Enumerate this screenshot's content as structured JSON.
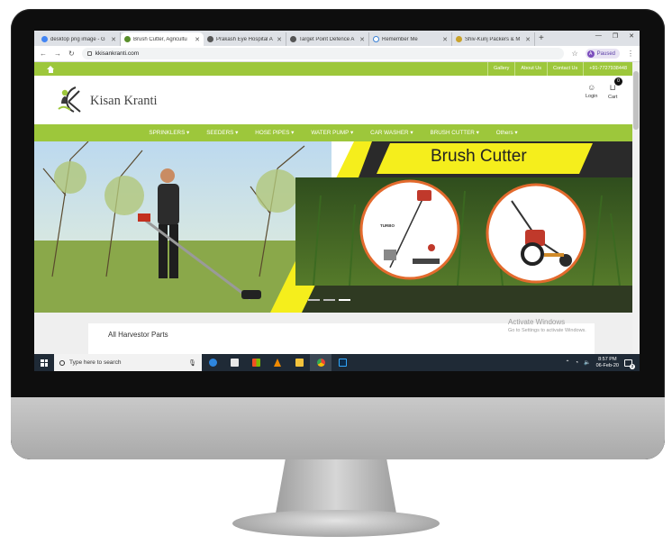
{
  "browser": {
    "tabs": [
      {
        "label": "desktop png image - G",
        "favicon_color": "#4285f4",
        "active": false
      },
      {
        "label": "Brush Cutter, Agricultu",
        "favicon_color": "#5a8f2c",
        "active": true
      },
      {
        "label": "Prakash Eye Hospital A",
        "favicon_color": "#555555",
        "active": false
      },
      {
        "label": "Target Point Defence A",
        "favicon_color": "#555555",
        "active": false
      },
      {
        "label": "Remember Me",
        "favicon_color": "#3b82d6",
        "active": false
      },
      {
        "label": "Shiv-Kunj Packers & M",
        "favicon_color": "#c9a22a",
        "active": false
      }
    ],
    "url": "kkisankranti.com",
    "profile_initial": "A",
    "profile_status": "Paused"
  },
  "site": {
    "toplinks": [
      "Gallery",
      "About Us",
      "Contact Us",
      "+91-7727938448"
    ],
    "logo_text": "Kisan Kranti",
    "header_actions": {
      "login": "Login",
      "cart": "Cart",
      "cart_count": "0"
    },
    "nav": [
      "SPRINKLERS",
      "SEEDERS",
      "HOSE PIPES",
      "WATER PUMP",
      "CAR WASHER",
      "BRUSH CUTTER",
      "Others"
    ],
    "hero": {
      "title": "Brush Cutter",
      "slide_count": 3,
      "active_slide": 3,
      "product_brand": "TURBO"
    },
    "section_title": "All Harvestor Parts"
  },
  "watermark": {
    "line1": "Activate Windows",
    "line2": "Go to Settings to activate Windows."
  },
  "taskbar": {
    "search_placeholder": "Type here to search",
    "apps": [
      "edge",
      "mail",
      "store",
      "vlc",
      "file-explorer",
      "chrome",
      "photoshop"
    ],
    "time": "8:57 PM",
    "date": "06-Feb-20",
    "notification_count": "2"
  },
  "colors": {
    "brand_green": "#9dc73b",
    "hero_yellow": "#f5ee1c",
    "taskbar": "#1f2a36"
  }
}
